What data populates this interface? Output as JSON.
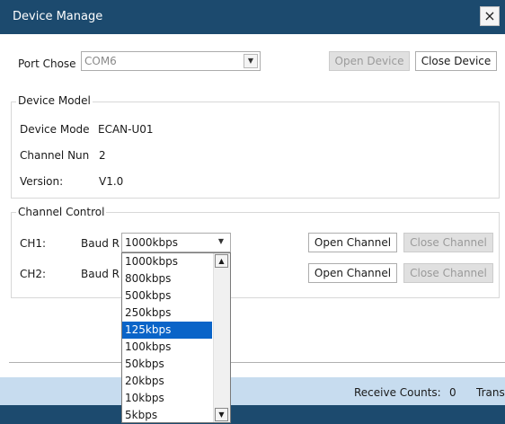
{
  "window": {
    "title": "Device Manage",
    "close_label": "×"
  },
  "port": {
    "label": "Port Chose",
    "selected": "COM6",
    "open_button": "Open Device",
    "close_button": "Close Device"
  },
  "device_model": {
    "legend": "Device Model",
    "model_label": "Device Mode",
    "model_value": "ECAN-U01",
    "channel_label": "Channel Nun",
    "channel_value": "2",
    "version_label": "Version:",
    "version_value": "V1.0"
  },
  "channel_control": {
    "legend": "Channel Control",
    "channels": [
      {
        "name": "CH1:",
        "baud_label": "Baud R",
        "baud_value": "1000kbps",
        "open_label": "Open Channel",
        "close_label": "Close Channel"
      },
      {
        "name": "CH2:",
        "baud_label": "Baud R",
        "open_label": "Open Channel",
        "close_label": "Close Channel"
      }
    ]
  },
  "baud_dropdown": {
    "options": [
      "1000kbps",
      "800kbps",
      "500kbps",
      "250kbps",
      "125kbps",
      "100kbps",
      "50kbps",
      "20kbps",
      "10kbps",
      "5kbps"
    ],
    "highlighted_index": 4
  },
  "status": {
    "receive_label": "Receive Counts:",
    "receive_value": "0",
    "transmit_label": "Trans"
  },
  "colors": {
    "titlebar": "#1c4a6e",
    "statusbar": "#c7dcef",
    "selection": "#0a64c8"
  }
}
